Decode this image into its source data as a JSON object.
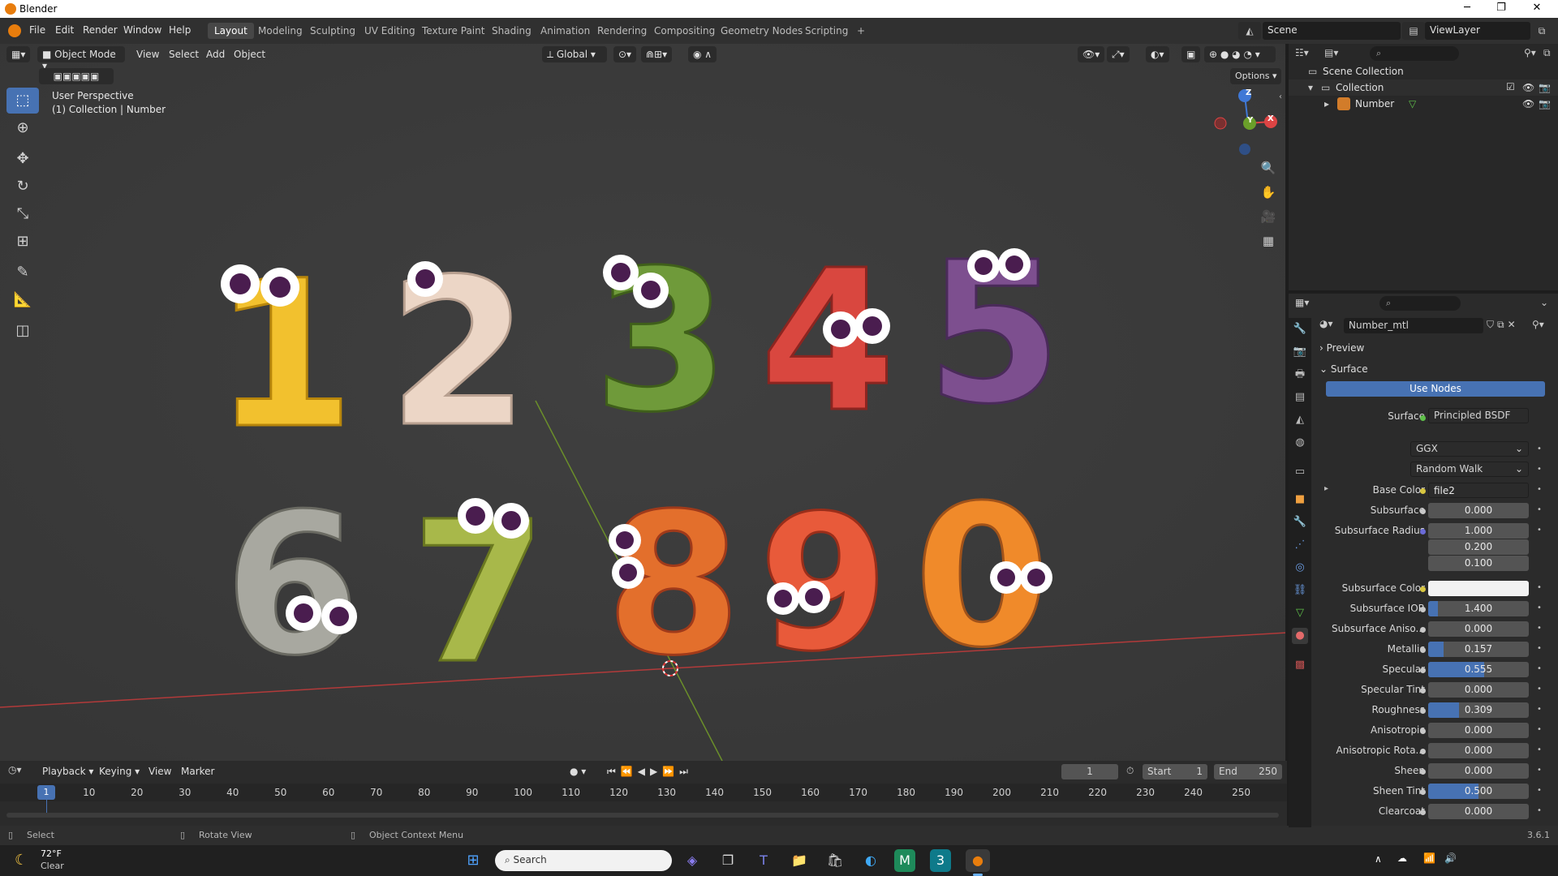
{
  "titlebar": {
    "title": "Blender",
    "min": "─",
    "max": "❐",
    "close": "✕"
  },
  "menu": [
    "File",
    "Edit",
    "Render",
    "Window",
    "Help"
  ],
  "workspaces": [
    "Layout",
    "Modeling",
    "Sculpting",
    "UV Editing",
    "Texture Paint",
    "Shading",
    "Animation",
    "Rendering",
    "Compositing",
    "Geometry Nodes",
    "Scripting",
    "+"
  ],
  "scene": {
    "name": "Scene",
    "view_layer": "ViewLayer"
  },
  "viewport": {
    "mode": "Object Mode",
    "menus": [
      "View",
      "Select",
      "Add",
      "Object"
    ],
    "orientation": "Global",
    "options": "Options",
    "overlay_line1": "User Perspective",
    "overlay_line2": "(1) Collection | Number",
    "gizmo_axes": {
      "z": "Z",
      "y": "Y",
      "x": "X"
    },
    "numerals": [
      "1",
      "2",
      "3",
      "4",
      "5",
      "6",
      "7",
      "8",
      "9",
      "0"
    ],
    "colors": {
      "1": "#f2c12e",
      "2": "#ecd6c6",
      "3": "#6f9a3a",
      "4": "#d9473f",
      "5": "#7d4f8f",
      "6": "#a8a8a0",
      "7": "#a8b84a",
      "8": "#e36f2c",
      "9": "#e85a3a",
      "0": "#f08a2a"
    }
  },
  "timeline": {
    "menus": [
      "Playback",
      "Keying",
      "View",
      "Marker"
    ],
    "current_frame": "1",
    "start_label": "Start",
    "start": "1",
    "end_label": "End",
    "end": "250",
    "ticks": [
      "10",
      "20",
      "30",
      "40",
      "50",
      "60",
      "70",
      "80",
      "90",
      "100",
      "110",
      "120",
      "130",
      "140",
      "150",
      "160",
      "170",
      "180",
      "190",
      "200",
      "210",
      "220",
      "230",
      "240",
      "250"
    ]
  },
  "status": {
    "select": "Select",
    "rotate": "Rotate View",
    "context": "Object Context Menu",
    "version": "3.6.1"
  },
  "outliner": {
    "scene_collection": "Scene Collection",
    "collection": "Collection",
    "object": "Number"
  },
  "properties": {
    "material": "Number_mtl",
    "preview": "Preview",
    "surface_panel": "Surface",
    "use_nodes": "Use Nodes",
    "surface_label": "Surface",
    "surface_value": "Principled BSDF",
    "distribution": "GGX",
    "subsurface_method": "Random Walk",
    "rows": [
      {
        "label": "Base Color",
        "value": "file2",
        "fill": 0
      },
      {
        "label": "Subsurface",
        "value": "0.000",
        "fill": 0
      },
      {
        "label": "Subsurface Radius",
        "value": "1.000",
        "fill": 0
      },
      {
        "label": "",
        "value": "0.200",
        "fill": 0
      },
      {
        "label": "",
        "value": "0.100",
        "fill": 0
      },
      {
        "label": "Subsurface Color",
        "value": "",
        "fill": 0
      },
      {
        "label": "Subsurface IOR",
        "value": "1.400",
        "fill": 0.1
      },
      {
        "label": "Subsurface Aniso...",
        "value": "0.000",
        "fill": 0
      },
      {
        "label": "Metallic",
        "value": "0.157",
        "fill": 0.157
      },
      {
        "label": "Specular",
        "value": "0.555",
        "fill": 0.555
      },
      {
        "label": "Specular Tint",
        "value": "0.000",
        "fill": 0
      },
      {
        "label": "Roughness",
        "value": "0.309",
        "fill": 0.309
      },
      {
        "label": "Anisotropic",
        "value": "0.000",
        "fill": 0
      },
      {
        "label": "Anisotropic Rota...",
        "value": "0.000",
        "fill": 0
      },
      {
        "label": "Sheen",
        "value": "0.000",
        "fill": 0
      },
      {
        "label": "Sheen Tint",
        "value": "0.500",
        "fill": 0.5
      },
      {
        "label": "Clearcoat",
        "value": "0.000",
        "fill": 0
      }
    ]
  },
  "taskbar": {
    "temp": "72°F",
    "weather": "Clear",
    "search_placeholder": "Search"
  }
}
